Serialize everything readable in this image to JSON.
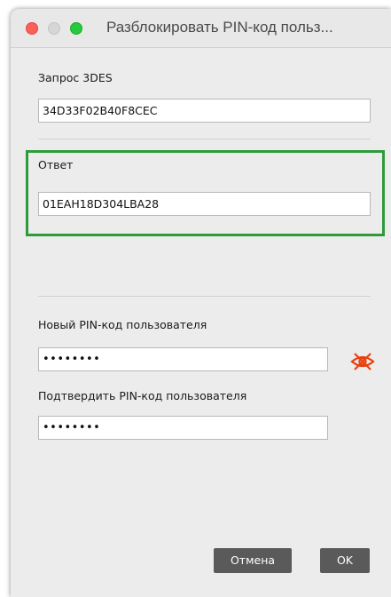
{
  "window": {
    "title": "Разблокировать PIN-код польз..."
  },
  "request": {
    "label": "Запрос 3DES",
    "value": "34D33F02B40F8CEC"
  },
  "response": {
    "label": "Ответ",
    "value": "01EAH18D304LBA28"
  },
  "new_pin": {
    "label": "Новый PIN-код пользователя",
    "value": "••••••••"
  },
  "confirm_pin": {
    "label": "Подтвердить PIN-код пользователя",
    "value": "••••••••"
  },
  "buttons": {
    "cancel": "Отмена",
    "ok": "OK"
  },
  "icons": {
    "show_password": "eye-icon"
  },
  "colors": {
    "highlight": "#2e9b3a",
    "eye_icon": "#e8400f",
    "button_bg": "#5a5a5a",
    "close": "#fe5f57",
    "maximize": "#28c840"
  }
}
